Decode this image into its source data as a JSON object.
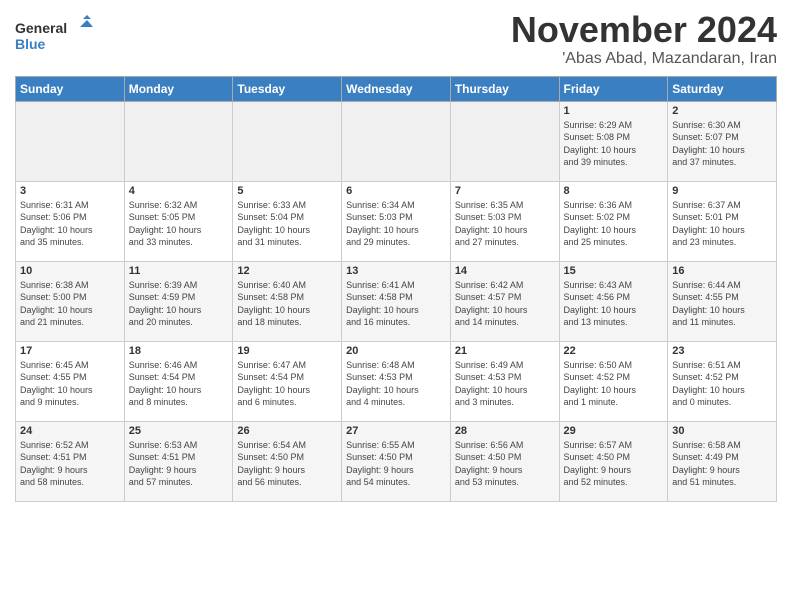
{
  "header": {
    "logo_line1": "General",
    "logo_line2": "Blue",
    "month": "November 2024",
    "location": "'Abas Abad, Mazandaran, Iran"
  },
  "weekdays": [
    "Sunday",
    "Monday",
    "Tuesday",
    "Wednesday",
    "Thursday",
    "Friday",
    "Saturday"
  ],
  "weeks": [
    [
      {
        "day": "",
        "info": ""
      },
      {
        "day": "",
        "info": ""
      },
      {
        "day": "",
        "info": ""
      },
      {
        "day": "",
        "info": ""
      },
      {
        "day": "",
        "info": ""
      },
      {
        "day": "1",
        "info": "Sunrise: 6:29 AM\nSunset: 5:08 PM\nDaylight: 10 hours\nand 39 minutes."
      },
      {
        "day": "2",
        "info": "Sunrise: 6:30 AM\nSunset: 5:07 PM\nDaylight: 10 hours\nand 37 minutes."
      }
    ],
    [
      {
        "day": "3",
        "info": "Sunrise: 6:31 AM\nSunset: 5:06 PM\nDaylight: 10 hours\nand 35 minutes."
      },
      {
        "day": "4",
        "info": "Sunrise: 6:32 AM\nSunset: 5:05 PM\nDaylight: 10 hours\nand 33 minutes."
      },
      {
        "day": "5",
        "info": "Sunrise: 6:33 AM\nSunset: 5:04 PM\nDaylight: 10 hours\nand 31 minutes."
      },
      {
        "day": "6",
        "info": "Sunrise: 6:34 AM\nSunset: 5:03 PM\nDaylight: 10 hours\nand 29 minutes."
      },
      {
        "day": "7",
        "info": "Sunrise: 6:35 AM\nSunset: 5:03 PM\nDaylight: 10 hours\nand 27 minutes."
      },
      {
        "day": "8",
        "info": "Sunrise: 6:36 AM\nSunset: 5:02 PM\nDaylight: 10 hours\nand 25 minutes."
      },
      {
        "day": "9",
        "info": "Sunrise: 6:37 AM\nSunset: 5:01 PM\nDaylight: 10 hours\nand 23 minutes."
      }
    ],
    [
      {
        "day": "10",
        "info": "Sunrise: 6:38 AM\nSunset: 5:00 PM\nDaylight: 10 hours\nand 21 minutes."
      },
      {
        "day": "11",
        "info": "Sunrise: 6:39 AM\nSunset: 4:59 PM\nDaylight: 10 hours\nand 20 minutes."
      },
      {
        "day": "12",
        "info": "Sunrise: 6:40 AM\nSunset: 4:58 PM\nDaylight: 10 hours\nand 18 minutes."
      },
      {
        "day": "13",
        "info": "Sunrise: 6:41 AM\nSunset: 4:58 PM\nDaylight: 10 hours\nand 16 minutes."
      },
      {
        "day": "14",
        "info": "Sunrise: 6:42 AM\nSunset: 4:57 PM\nDaylight: 10 hours\nand 14 minutes."
      },
      {
        "day": "15",
        "info": "Sunrise: 6:43 AM\nSunset: 4:56 PM\nDaylight: 10 hours\nand 13 minutes."
      },
      {
        "day": "16",
        "info": "Sunrise: 6:44 AM\nSunset: 4:55 PM\nDaylight: 10 hours\nand 11 minutes."
      }
    ],
    [
      {
        "day": "17",
        "info": "Sunrise: 6:45 AM\nSunset: 4:55 PM\nDaylight: 10 hours\nand 9 minutes."
      },
      {
        "day": "18",
        "info": "Sunrise: 6:46 AM\nSunset: 4:54 PM\nDaylight: 10 hours\nand 8 minutes."
      },
      {
        "day": "19",
        "info": "Sunrise: 6:47 AM\nSunset: 4:54 PM\nDaylight: 10 hours\nand 6 minutes."
      },
      {
        "day": "20",
        "info": "Sunrise: 6:48 AM\nSunset: 4:53 PM\nDaylight: 10 hours\nand 4 minutes."
      },
      {
        "day": "21",
        "info": "Sunrise: 6:49 AM\nSunset: 4:53 PM\nDaylight: 10 hours\nand 3 minutes."
      },
      {
        "day": "22",
        "info": "Sunrise: 6:50 AM\nSunset: 4:52 PM\nDaylight: 10 hours\nand 1 minute."
      },
      {
        "day": "23",
        "info": "Sunrise: 6:51 AM\nSunset: 4:52 PM\nDaylight: 10 hours\nand 0 minutes."
      }
    ],
    [
      {
        "day": "24",
        "info": "Sunrise: 6:52 AM\nSunset: 4:51 PM\nDaylight: 9 hours\nand 58 minutes."
      },
      {
        "day": "25",
        "info": "Sunrise: 6:53 AM\nSunset: 4:51 PM\nDaylight: 9 hours\nand 57 minutes."
      },
      {
        "day": "26",
        "info": "Sunrise: 6:54 AM\nSunset: 4:50 PM\nDaylight: 9 hours\nand 56 minutes."
      },
      {
        "day": "27",
        "info": "Sunrise: 6:55 AM\nSunset: 4:50 PM\nDaylight: 9 hours\nand 54 minutes."
      },
      {
        "day": "28",
        "info": "Sunrise: 6:56 AM\nSunset: 4:50 PM\nDaylight: 9 hours\nand 53 minutes."
      },
      {
        "day": "29",
        "info": "Sunrise: 6:57 AM\nSunset: 4:50 PM\nDaylight: 9 hours\nand 52 minutes."
      },
      {
        "day": "30",
        "info": "Sunrise: 6:58 AM\nSunset: 4:49 PM\nDaylight: 9 hours\nand 51 minutes."
      }
    ]
  ]
}
